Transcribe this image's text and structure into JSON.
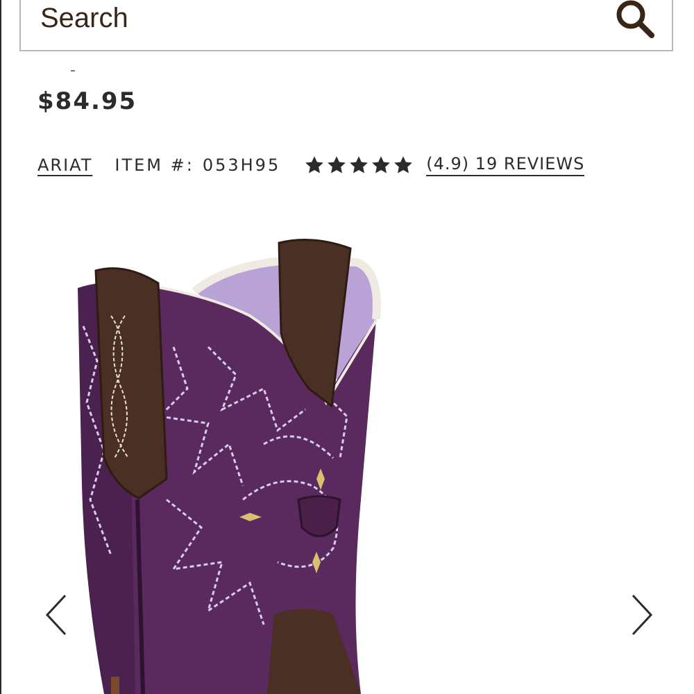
{
  "search": {
    "placeholder": "Search",
    "icon": "search-icon"
  },
  "product": {
    "price": "$84.95",
    "brand": "ARIAT",
    "item_label": "ITEM #:",
    "item_number": "053H95",
    "rating": 4.9,
    "rating_max": 5,
    "reviews_text": "(4.9) 19 REVIEWS"
  },
  "gallery": {
    "prev_icon": "chevron-left-icon",
    "next_icon": "chevron-right-icon",
    "image_subject": "purple western cowboy boot with brown pull straps and white stitching"
  },
  "colors": {
    "text": "#2b2b2b",
    "search_text": "#3a2416",
    "boot_purple": "#5a2a5e",
    "strap_brown": "#4a3024",
    "lining_lavender": "#b8a2d6"
  }
}
